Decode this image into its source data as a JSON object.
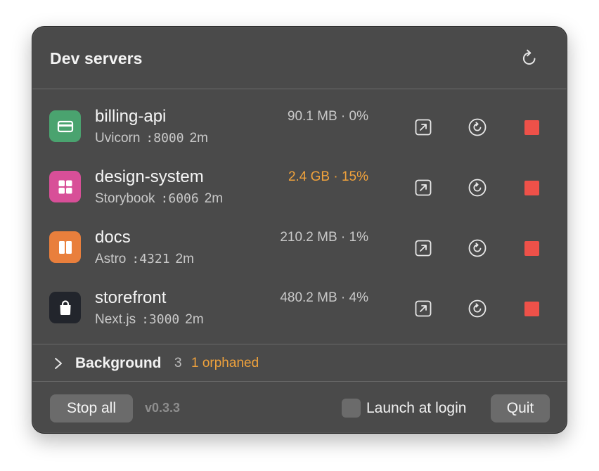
{
  "header": {
    "title": "Dev servers",
    "refresh_icon": "refresh-icon"
  },
  "servers": [
    {
      "name": "billing-api",
      "framework": "Uvicorn",
      "port": ":8000",
      "uptime": "2m",
      "stats": "90.1 MB · 0%",
      "warn": false,
      "icon": "credit-card-icon",
      "icon_color": "#4aa36f"
    },
    {
      "name": "design-system",
      "framework": "Storybook",
      "port": ":6006",
      "uptime": "2m",
      "stats": "2.4 GB · 15%",
      "warn": true,
      "icon": "grid-icon",
      "icon_color": "#d84f98"
    },
    {
      "name": "docs",
      "framework": "Astro",
      "port": ":4321",
      "uptime": "2m",
      "stats": "210.2 MB · 1%",
      "warn": false,
      "icon": "book-icon",
      "icon_color": "#e97f3c"
    },
    {
      "name": "storefront",
      "framework": "Next.js",
      "port": ":3000",
      "uptime": "2m",
      "stats": "480.2 MB · 4%",
      "warn": false,
      "icon": "shopping-bag-icon",
      "icon_color": "#22252c"
    }
  ],
  "row_actions": {
    "open_icon": "open-external-icon",
    "restart_icon": "restart-icon",
    "stop_icon": "stop-icon"
  },
  "background": {
    "label": "Background",
    "count": "3",
    "orphaned": "1 orphaned",
    "chevron_icon": "chevron-right-icon"
  },
  "footer": {
    "stop_all_label": "Stop all",
    "version": "v0.3.3",
    "launch_at_login_label": "Launch at login",
    "launch_at_login_checked": false,
    "quit_label": "Quit"
  },
  "colors": {
    "panel_bg": "#4a4a4a",
    "warning": "#f0a23c",
    "stop_red": "#ee5149",
    "button_bg": "#6b6b6b"
  }
}
